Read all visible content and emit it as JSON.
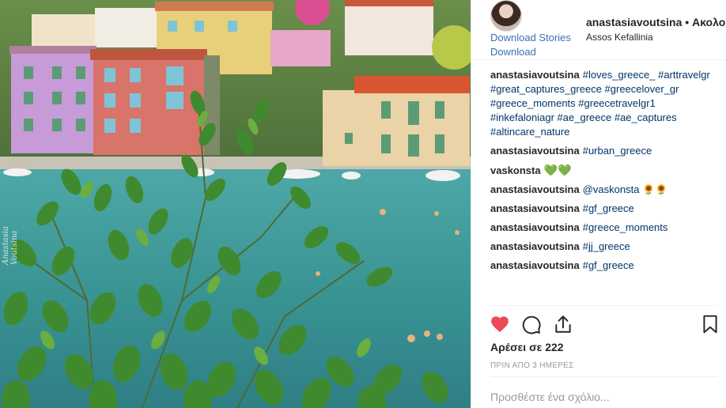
{
  "photo": {
    "alt_icon": "harbor-photo",
    "signature": "Anastasia Voutsina"
  },
  "header": {
    "username": "anastasiavoutsina",
    "separator": "•",
    "follow_label": "Ακολο",
    "location": "Assos Kefallinia",
    "download_stories": "Download Stories",
    "download": "Download"
  },
  "comments": [
    {
      "user": "anastasiavoutsina",
      "text": "#loves_greece_ #arttravelgr #great_captures_greece #greecelover_gr #greece_moments #greecetravelgr1 #inkefaloniagr #ae_greece #ae_captures #altincare_nature"
    },
    {
      "user": "anastasiavoutsina",
      "text": "#urban_greece"
    },
    {
      "user": "vaskonsta",
      "text": "💚💚"
    },
    {
      "user": "anastasiavoutsina",
      "text": "@vaskonsta 🌻🌻"
    },
    {
      "user": "anastasiavoutsina",
      "text": "#gf_greece"
    },
    {
      "user": "anastasiavoutsina",
      "text": "#greece_moments"
    },
    {
      "user": "anastasiavoutsina",
      "text": "#jj_greece"
    },
    {
      "user": "anastasiavoutsina",
      "text": "#gf_greece"
    }
  ],
  "actions": {
    "like_icon": "heart-icon",
    "like_color": "#ed4956",
    "comment_icon": "comment-icon",
    "share_icon": "share-icon",
    "save_icon": "bookmark-icon"
  },
  "likes": "Αρέσει σε 222",
  "timestamp": "ΠΡΙΝ ΑΠΟ 3 ΗΜΕΡΕΣ",
  "add_comment": {
    "placeholder": "Προσθέστε ένα σχόλιο..."
  }
}
